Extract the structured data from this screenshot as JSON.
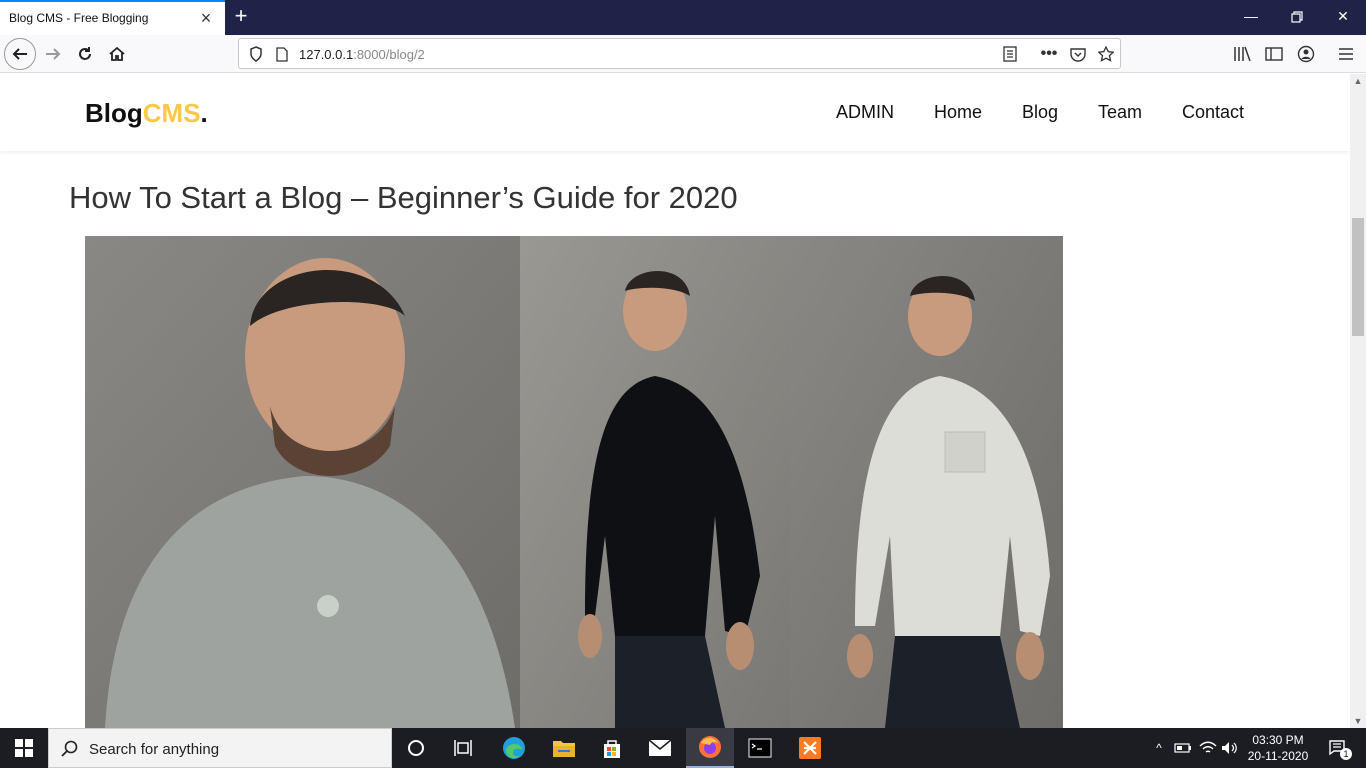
{
  "browser": {
    "tab_title": "Blog CMS - Free Blogging",
    "url_host": "127.0.0.1",
    "url_path": ":8000/blog/2"
  },
  "site": {
    "logo_main": "Blog",
    "logo_accent": "CMS",
    "logo_dot": ".",
    "nav": [
      "ADMIN",
      "Home",
      "Blog",
      "Team",
      "Contact"
    ]
  },
  "post": {
    "title": "How To Start a Blog – Beginner’s Guide for 2020"
  },
  "taskbar": {
    "search_placeholder": "Search for anything",
    "time": "03:30 PM",
    "date": "20-11-2020",
    "notification_count": "1"
  },
  "colors": {
    "accent": "#f9c846",
    "tab_strip": "#1f2347",
    "taskbar": "#1c1d22"
  }
}
